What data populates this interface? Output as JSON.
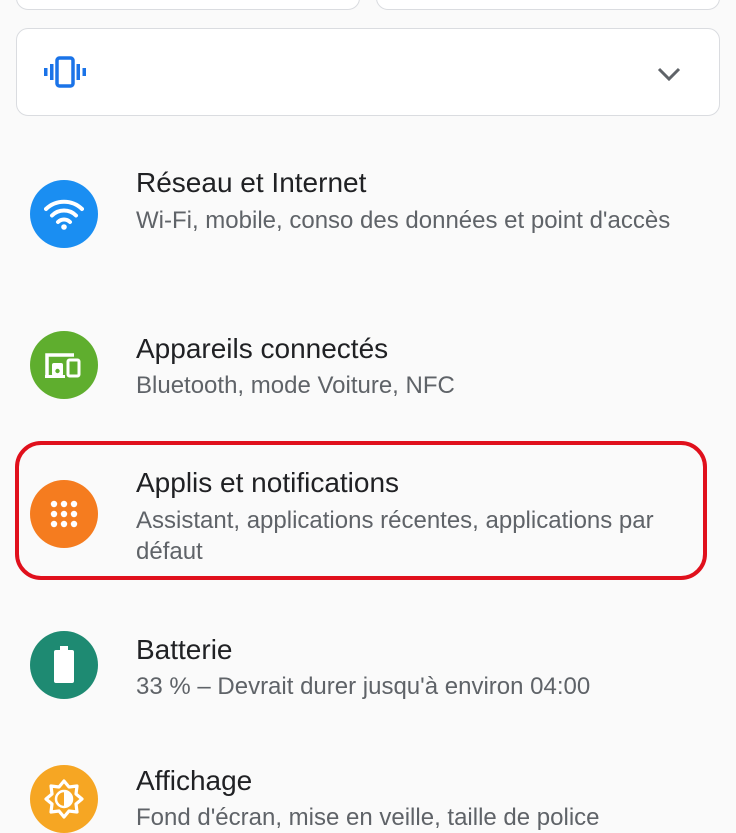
{
  "quick_settings": {
    "sound_mode_icon": "vibrate-icon",
    "expand_icon": "chevron-down-icon"
  },
  "settings_items": [
    {
      "title": "Réseau et Internet",
      "subtitle": "Wi-Fi, mobile, conso des données et point d'accès",
      "icon": "wifi-icon",
      "color": "#1a8ef2"
    },
    {
      "title": "Appareils connectés",
      "subtitle": "Bluetooth, mode Voiture, NFC",
      "icon": "connected-devices-icon",
      "color": "#5fae2e"
    },
    {
      "title": "Applis et notifications",
      "subtitle": "Assistant, applications récentes, applications par défaut",
      "icon": "apps-grid-icon",
      "color": "#f57c1f",
      "highlighted": true
    },
    {
      "title": "Batterie",
      "subtitle": "33 % – Devrait durer jusqu'à environ 04:00",
      "icon": "battery-icon",
      "color": "#1e8a72"
    },
    {
      "title": "Affichage",
      "subtitle": "Fond d'écran, mise en veille, taille de police",
      "icon": "brightness-icon",
      "color": "#f6a623"
    }
  ],
  "highlight_color": "#e0101c"
}
